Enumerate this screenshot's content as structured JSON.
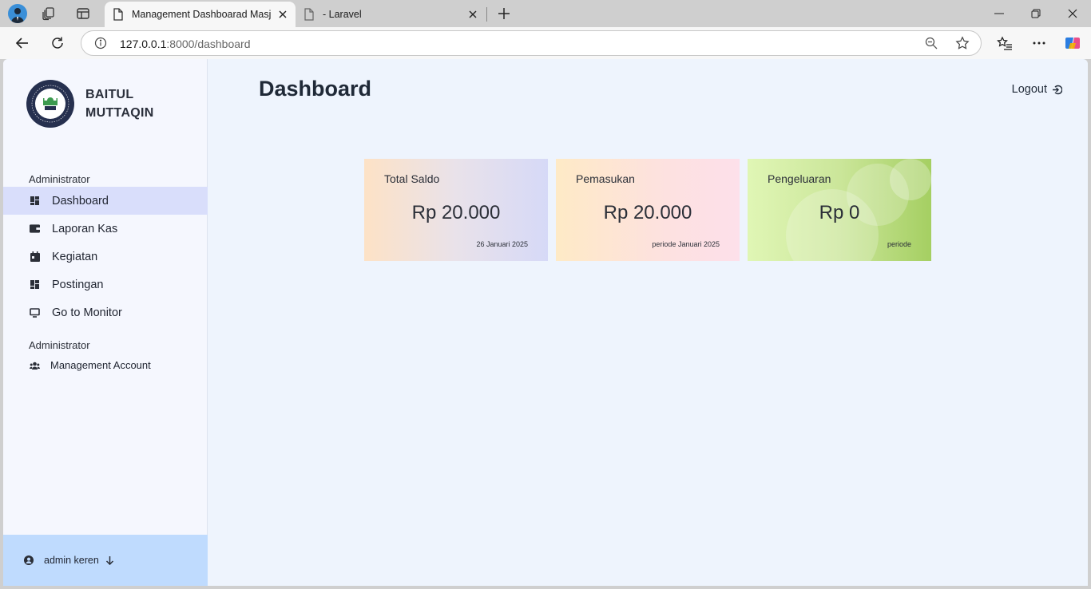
{
  "browser": {
    "active_tab_title": "Management Dashboarad Masjid",
    "inactive_tab_title": "- Laravel",
    "url_host": "127.0.0.1",
    "url_rest": ":8000/dashboard"
  },
  "sidebar": {
    "brand_line1": "BAITUL",
    "brand_line2": "MUTTAQIN",
    "section1_label": "Administrator",
    "items": [
      {
        "label": "Dashboard",
        "icon": "dashboard-icon",
        "active": true
      },
      {
        "label": "Laporan Kas",
        "icon": "wallet-icon",
        "active": false
      },
      {
        "label": "Kegiatan",
        "icon": "calendar-icon",
        "active": false
      },
      {
        "label": "Postingan",
        "icon": "dashboard-icon",
        "active": false
      },
      {
        "label": "Go to Monitor",
        "icon": "monitor-icon",
        "active": false
      }
    ],
    "section2_label": "Administrator",
    "account_item": {
      "label": "Management Account",
      "icon": "users-icon"
    },
    "user": {
      "name": "admin keren",
      "icon": "user-circle-icon"
    }
  },
  "main": {
    "title": "Dashboard",
    "logout_label": "Logout",
    "cards": [
      {
        "label": "Total Saldo",
        "value": "Rp 20.000",
        "note": "26 Januari 2025"
      },
      {
        "label": "Pemasukan",
        "value": "Rp 20.000",
        "note": "periode Januari 2025"
      },
      {
        "label": "Pengeluaran",
        "value": "Rp 0",
        "note": "periode"
      }
    ]
  },
  "colors": {
    "sidebar_bg": "#f5f7fe",
    "active_item_bg": "#d9defb",
    "footer_bg": "#bfdbfe",
    "page_bg": "#eef4fd"
  }
}
